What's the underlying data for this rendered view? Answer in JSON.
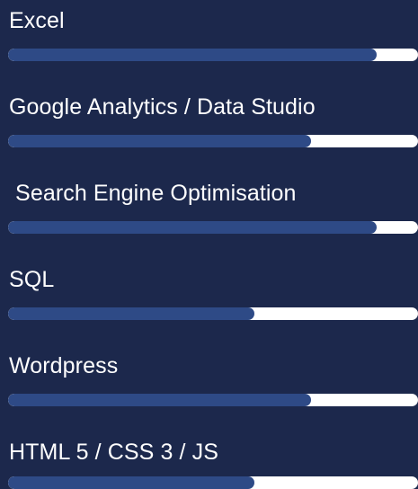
{
  "skills": [
    {
      "label": "Excel",
      "level_percent": 90
    },
    {
      "label": "Google Analytics / Data Studio",
      "level_percent": 74
    },
    {
      "label": " Search Engine Optimisation",
      "level_percent": 90
    },
    {
      "label": "SQL",
      "level_percent": 60
    },
    {
      "label": "Wordpress",
      "level_percent": 74
    },
    {
      "label": "HTML 5 / CSS 3 / JS",
      "level_percent": 60
    }
  ],
  "colors": {
    "background": "#1c284c",
    "bar_track": "#ffffff",
    "bar_fill": "#2e4a86",
    "label_text": "#ffffff"
  }
}
